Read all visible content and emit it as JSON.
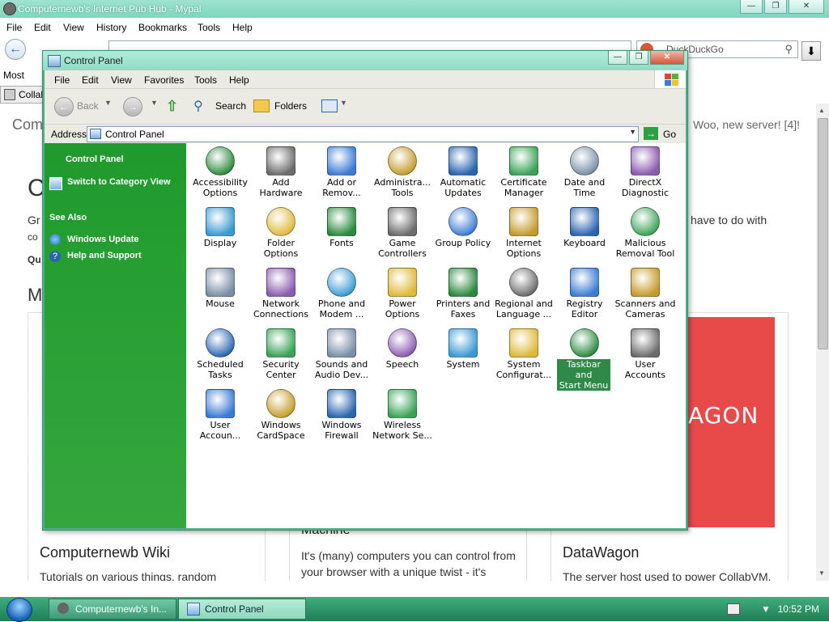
{
  "browser": {
    "title": "Computernewb's Internet Pub Hub - Mypal",
    "menu": [
      "File",
      "Edit",
      "View",
      "History",
      "Bookmarks",
      "Tools",
      "Help"
    ],
    "search_placeholder": "DuckDuckGo",
    "bookmarks": [
      "Most",
      "Collal"
    ],
    "page": {
      "heading_left": "Com",
      "heading_c": "C",
      "line_gr": "Gr",
      "line_co": "co",
      "line_qu": "Qu",
      "heading_m": "M",
      "right_notice": "Woo, new server! [4]!",
      "right_text": "have to do with",
      "cards": [
        {
          "title": "Computernewb Wiki",
          "body": "Tutorials on various things, random"
        },
        {
          "title": "Machine",
          "body": "It's (many) computers you can control from your browser with a unique twist - it's"
        },
        {
          "title": "DataWagon",
          "body": "The server host used to power CollabVM."
        }
      ],
      "datawagon_banner": "AGON"
    }
  },
  "control_panel": {
    "title": "Control Panel",
    "menu": [
      "File",
      "Edit",
      "View",
      "Favorites",
      "Tools",
      "Help"
    ],
    "toolbar": {
      "back": "Back",
      "search": "Search",
      "folders": "Folders"
    },
    "address": {
      "label": "Address",
      "value": "Control Panel",
      "go": "Go"
    },
    "sidebar": {
      "panel_title": "Control Panel",
      "switch_view": "Switch to Category View",
      "see_also": "See Also",
      "links": [
        "Windows Update",
        "Help and Support"
      ]
    },
    "items": [
      {
        "line1": "Accessibility",
        "line2": "Options",
        "icon": "accessibility-icon"
      },
      {
        "line1": "Add",
        "line2": "Hardware",
        "icon": "add-hardware-icon"
      },
      {
        "line1": "Add or",
        "line2": "Remov...",
        "icon": "add-remove-programs-icon"
      },
      {
        "line1": "Administra...",
        "line2": "Tools",
        "icon": "admin-tools-icon"
      },
      {
        "line1": "Automatic",
        "line2": "Updates",
        "icon": "automatic-updates-icon"
      },
      {
        "line1": "Certificate",
        "line2": "Manager",
        "icon": "certificate-icon"
      },
      {
        "line1": "Date and",
        "line2": "Time",
        "icon": "date-time-icon"
      },
      {
        "line1": "DirectX",
        "line2": "Diagnostic",
        "icon": "directx-icon"
      },
      {
        "line1": "Display",
        "line2": "",
        "icon": "display-icon"
      },
      {
        "line1": "Folder",
        "line2": "Options",
        "icon": "folder-options-icon"
      },
      {
        "line1": "Fonts",
        "line2": "",
        "icon": "fonts-icon"
      },
      {
        "line1": "Game",
        "line2": "Controllers",
        "icon": "gamepad-icon"
      },
      {
        "line1": "Group Policy",
        "line2": "",
        "icon": "group-policy-icon"
      },
      {
        "line1": "Internet",
        "line2": "Options",
        "icon": "internet-options-icon"
      },
      {
        "line1": "Keyboard",
        "line2": "",
        "icon": "keyboard-icon"
      },
      {
        "line1": "Malicious",
        "line2": "Removal Tool",
        "icon": "malware-tool-icon"
      },
      {
        "line1": "Mouse",
        "line2": "",
        "icon": "mouse-icon"
      },
      {
        "line1": "Network",
        "line2": "Connections",
        "icon": "network-icon"
      },
      {
        "line1": "Phone and",
        "line2": "Modem ...",
        "icon": "phone-modem-icon"
      },
      {
        "line1": "Power",
        "line2": "Options",
        "icon": "power-icon"
      },
      {
        "line1": "Printers and",
        "line2": "Faxes",
        "icon": "printer-icon"
      },
      {
        "line1": "Regional and",
        "line2": "Language ...",
        "icon": "regional-icon"
      },
      {
        "line1": "Registry",
        "line2": "Editor",
        "icon": "registry-icon"
      },
      {
        "line1": "Scanners and",
        "line2": "Cameras",
        "icon": "scanner-icon"
      },
      {
        "line1": "Scheduled",
        "line2": "Tasks",
        "icon": "scheduled-tasks-icon"
      },
      {
        "line1": "Security",
        "line2": "Center",
        "icon": "shield-icon"
      },
      {
        "line1": "Sounds and",
        "line2": "Audio Dev...",
        "icon": "speaker-icon"
      },
      {
        "line1": "Speech",
        "line2": "",
        "icon": "speech-icon"
      },
      {
        "line1": "System",
        "line2": "",
        "icon": "system-icon"
      },
      {
        "line1": "System",
        "line2": "Configurat...",
        "icon": "system-config-icon"
      },
      {
        "line1": "Taskbar and",
        "line2": "Start Menu",
        "icon": "taskbar-icon"
      },
      {
        "line1": "User",
        "line2": "Accounts",
        "icon": "users-icon"
      },
      {
        "line1": "User",
        "line2": "Accoun...",
        "icon": "user-accounts-2-icon"
      },
      {
        "line1": "Windows",
        "line2": "CardSpace",
        "icon": "cardspace-icon"
      },
      {
        "line1": "Windows",
        "line2": "Firewall",
        "icon": "firewall-icon"
      },
      {
        "line1": "Wireless",
        "line2": "Network Se...",
        "icon": "wireless-icon"
      }
    ],
    "selected_item": "Taskbar and Start Menu"
  },
  "taskbar": {
    "buttons": [
      "Computernewb's In...",
      "Control Panel"
    ],
    "clock": "10:52 PM"
  },
  "colors": {
    "sidebar_green": "#2b9a36",
    "selection_green": "#2f8a48",
    "taskbar_green": "#2f9468",
    "datawagon_red": "#e84a4a"
  }
}
